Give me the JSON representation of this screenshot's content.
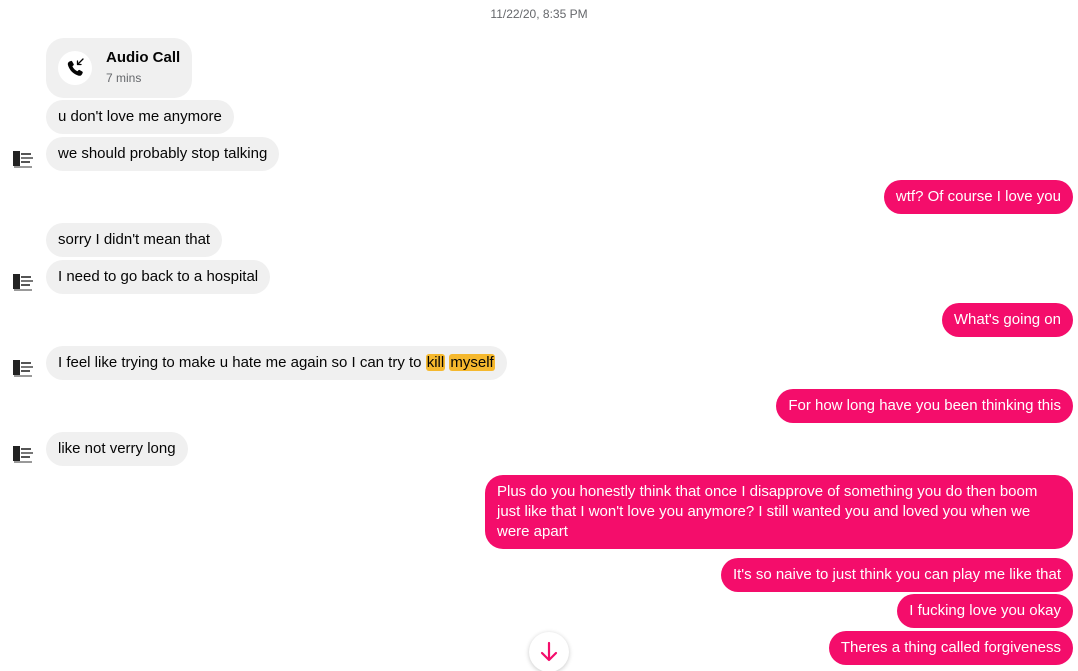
{
  "timestamp": "11/22/20, 8:35 PM",
  "accent_color": "#f40d6b",
  "highlight_color": "#f5b82e",
  "call": {
    "title": "Audio Call",
    "duration": "7 mins",
    "icon": "incoming-call-icon"
  },
  "incoming": [
    "u don't love me anymore",
    "we should probably stop talking",
    "sorry I didn't mean that",
    "I need to go back to a hospital",
    "I feel like trying to make u hate me again so I can try to ",
    "like not verry long"
  ],
  "incoming_highlights": [
    "kill",
    "myself"
  ],
  "outgoing": [
    "wtf? Of course I love you",
    "What's going on",
    "For how long have you been thinking this",
    "Plus do you honestly think that once I disapprove of something you do then boom just like that I won't love you anymore? I still wanted you and loved you when we were apart",
    "It's so naive to just think you can play me like that",
    "I fucking love you okay",
    "Theres a thing called forgiveness"
  ],
  "scroll_button_icon": "arrow-down-icon",
  "avatar_icon": "contact-avatar"
}
